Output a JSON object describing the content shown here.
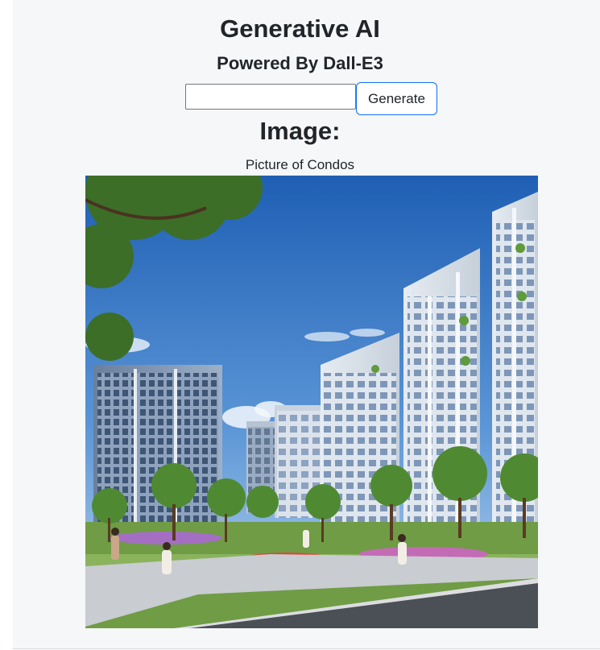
{
  "header": {
    "title": "Generative AI",
    "subtitle": "Powered By Dall-E3"
  },
  "form": {
    "prompt_value": "",
    "generate_label": "Generate"
  },
  "result": {
    "heading": "Image:",
    "caption": "Picture of Condos"
  }
}
